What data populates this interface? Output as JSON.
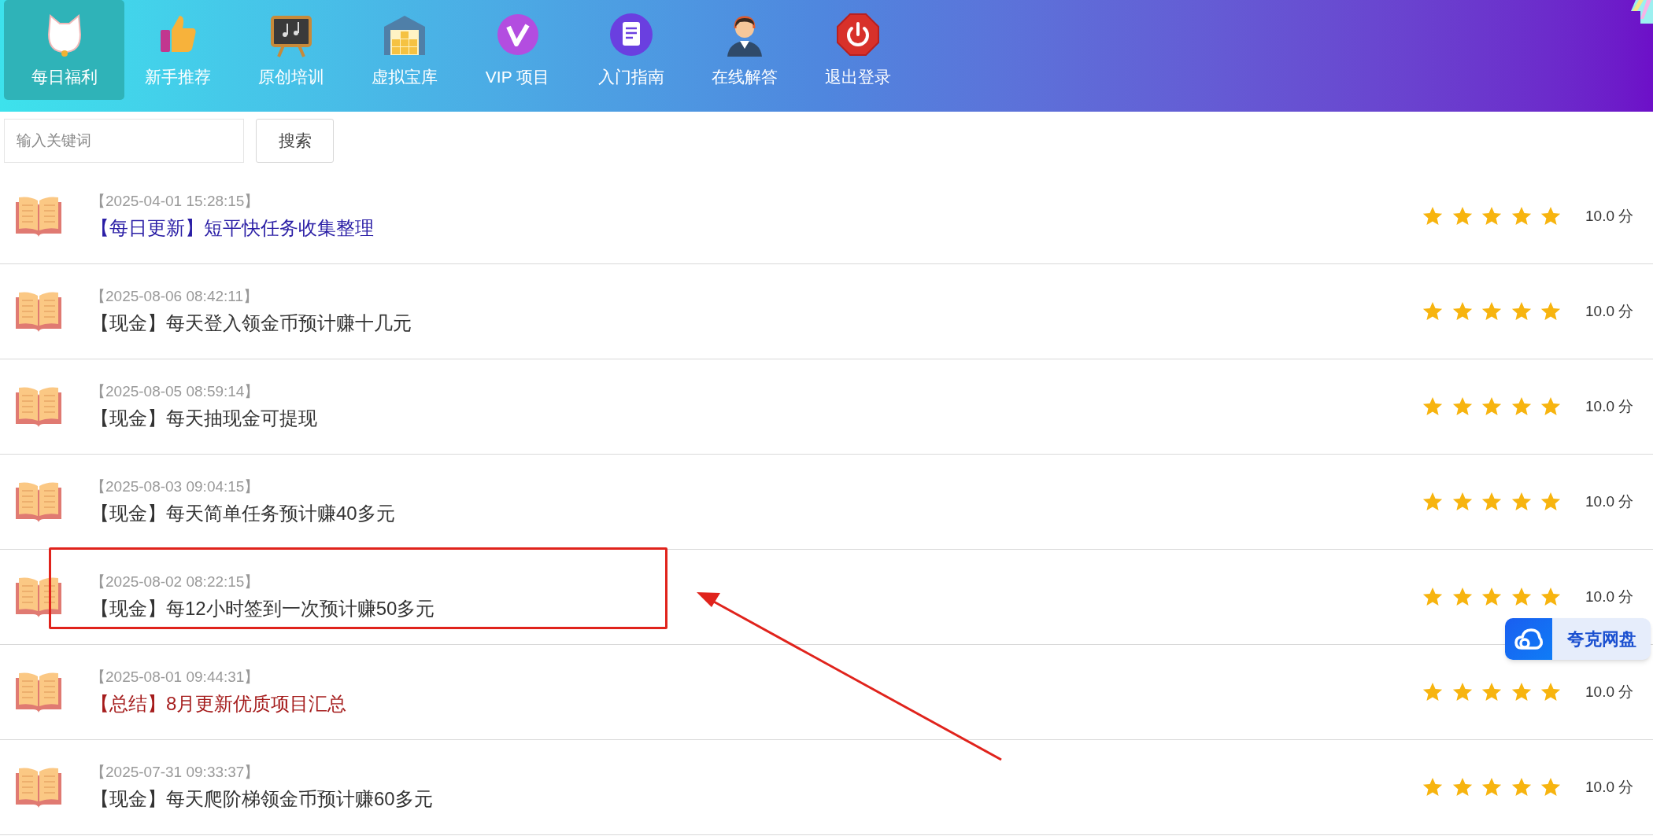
{
  "nav": [
    {
      "label": "每日福利",
      "selected": true
    },
    {
      "label": "新手推荐",
      "selected": false
    },
    {
      "label": "原创培训",
      "selected": false
    },
    {
      "label": "虚拟宝库",
      "selected": false
    },
    {
      "label": "VIP 项目",
      "selected": false
    },
    {
      "label": "入门指南",
      "selected": false
    },
    {
      "label": "在线解答",
      "selected": false
    },
    {
      "label": "退出登录",
      "selected": false
    }
  ],
  "search": {
    "placeholder": "输入关键词",
    "button": "搜索"
  },
  "articles": [
    {
      "date": "【2025-04-01 15:28:15】",
      "title": "【每日更新】短平快任务收集整理",
      "color": "#2b1fa6",
      "stars": 5,
      "score": "10.0 分"
    },
    {
      "date": "【2025-08-06 08:42:11】",
      "title": "【现金】每天登入领金币预计赚十几元",
      "color": "#333333",
      "stars": 5,
      "score": "10.0 分"
    },
    {
      "date": "【2025-08-05 08:59:14】",
      "title": "【现金】每天抽现金可提现",
      "color": "#333333",
      "stars": 5,
      "score": "10.0 分"
    },
    {
      "date": "【2025-08-03 09:04:15】",
      "title": "【现金】每天简单任务预计赚40多元",
      "color": "#333333",
      "stars": 5,
      "score": "10.0 分"
    },
    {
      "date": "【2025-08-02 08:22:15】",
      "title": "【现金】每12小时签到一次预计赚50多元",
      "color": "#333333",
      "stars": 5,
      "score": "10.0 分",
      "highlighted": true
    },
    {
      "date": "【2025-08-01 09:44:31】",
      "title": "【总结】8月更新优质项目汇总",
      "color": "#a51c1c",
      "stars": 5,
      "score": "10.0 分"
    },
    {
      "date": "【2025-07-31 09:33:37】",
      "title": "【现金】每天爬阶梯领金币预计赚60多元",
      "color": "#333333",
      "stars": 5,
      "score": "10.0 分"
    }
  ],
  "floating_widget": {
    "label": "夸克网盘"
  }
}
